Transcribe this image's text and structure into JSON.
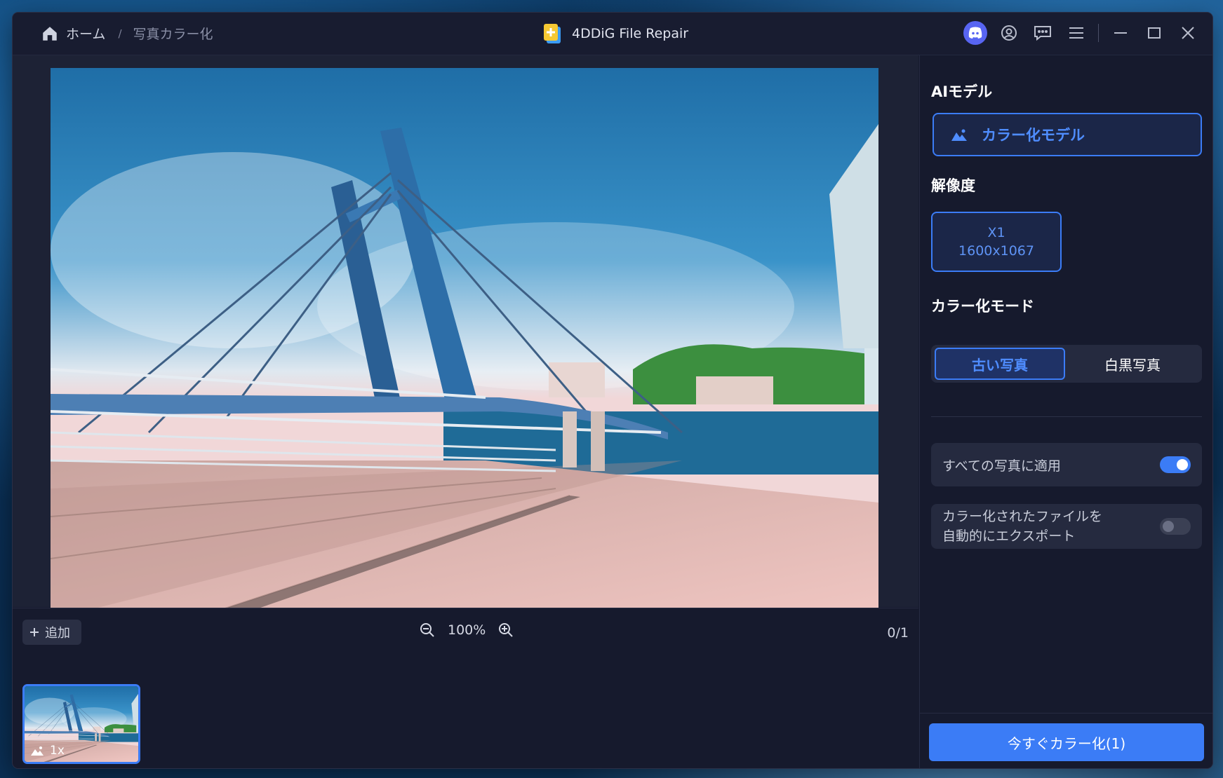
{
  "titlebar": {
    "breadcrumb_home": "ホーム",
    "breadcrumb_sep": "/",
    "breadcrumb_current": "写真カラー化",
    "app_title": "4DDiG File Repair"
  },
  "toolbar": {
    "add_label": "追加",
    "zoom_value": "100%",
    "page_counter": "0/1"
  },
  "thumbnail": {
    "scale_label": "1x"
  },
  "panel": {
    "ai_model_title": "AIモデル",
    "model_name": "カラー化モデル",
    "resolution_title": "解像度",
    "resolution_scale": "X1",
    "resolution_size": "1600x1067",
    "mode_title": "カラー化モード",
    "mode_old": "古い写真",
    "mode_bw": "白黒写真",
    "apply_all_label": "すべての写真に適用",
    "auto_export_line1": "カラー化されたファイルを",
    "auto_export_line2": "自動的にエクスポート",
    "colorize_button": "今すぐカラー化(1)"
  },
  "state": {
    "apply_all": true,
    "auto_export": false,
    "selected_mode": "古い写真"
  },
  "colors": {
    "accent": "#3b7cf6",
    "window_bg": "#161a2d",
    "panel_card": "#252a3f",
    "discord": "#5865f2"
  },
  "icons": [
    "home-icon",
    "app-logo-icon",
    "discord-icon",
    "account-icon",
    "feedback-icon",
    "menu-icon",
    "minimize-icon",
    "maximize-icon",
    "close-icon",
    "plus-icon",
    "zoom-out-icon",
    "zoom-in-icon",
    "image-icon"
  ]
}
